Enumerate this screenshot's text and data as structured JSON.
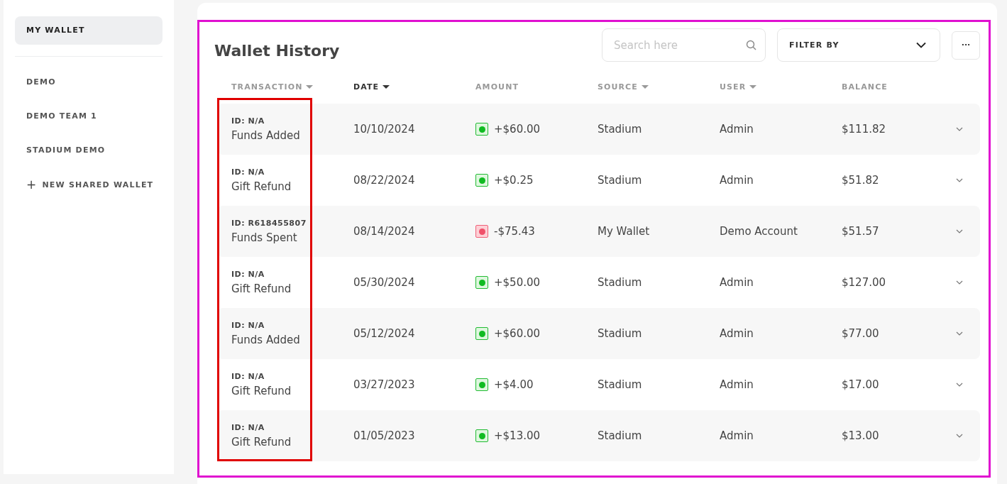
{
  "sidebar": {
    "items": [
      {
        "label": "MY WALLET",
        "selected": true
      },
      {
        "label": "DEMO",
        "selected": false
      },
      {
        "label": "DEMO TEAM 1",
        "selected": false
      },
      {
        "label": "STADIUM DEMO",
        "selected": false
      }
    ],
    "add_button": {
      "icon": "+",
      "label": "NEW SHARED WALLET"
    }
  },
  "wallet_history": {
    "title": "Wallet History",
    "search": {
      "placeholder": "Search here"
    },
    "filter": {
      "label": "FILTER BY"
    },
    "more_button": "···",
    "columns": [
      {
        "label": "TRANSACTION",
        "sortable": true,
        "active": false
      },
      {
        "label": "DATE",
        "sortable": true,
        "active": true
      },
      {
        "label": "AMOUNT",
        "sortable": false,
        "active": false
      },
      {
        "label": "SOURCE",
        "sortable": true,
        "active": false
      },
      {
        "label": "USER",
        "sortable": true,
        "active": false
      },
      {
        "label": "BALANCE",
        "sortable": false,
        "active": false
      }
    ],
    "rows": [
      {
        "id": "ID: N/A",
        "type": "Funds Added",
        "date": "10/10/2024",
        "kind": "credit",
        "amount": "+$60.00",
        "source": "Stadium",
        "user": "Admin",
        "balance": "$111.82"
      },
      {
        "id": "ID: N/A",
        "type": "Gift Refund",
        "date": "08/22/2024",
        "kind": "credit",
        "amount": "+$0.25",
        "source": "Stadium",
        "user": "Admin",
        "balance": "$51.82"
      },
      {
        "id": "ID: R618455807",
        "type": "Funds Spent",
        "date": "08/14/2024",
        "kind": "debit",
        "amount": "-$75.43",
        "source": "My Wallet",
        "user": "Demo Account",
        "balance": "$51.57"
      },
      {
        "id": "ID: N/A",
        "type": "Gift Refund",
        "date": "05/30/2024",
        "kind": "credit",
        "amount": "+$50.00",
        "source": "Stadium",
        "user": "Admin",
        "balance": "$127.00"
      },
      {
        "id": "ID: N/A",
        "type": "Funds Added",
        "date": "05/12/2024",
        "kind": "credit",
        "amount": "+$60.00",
        "source": "Stadium",
        "user": "Admin",
        "balance": "$77.00"
      },
      {
        "id": "ID: N/A",
        "type": "Gift Refund",
        "date": "03/27/2023",
        "kind": "credit",
        "amount": "+$4.00",
        "source": "Stadium",
        "user": "Admin",
        "balance": "$17.00"
      },
      {
        "id": "ID: N/A",
        "type": "Gift Refund",
        "date": "01/05/2023",
        "kind": "credit",
        "amount": "+$13.00",
        "source": "Stadium",
        "user": "Admin",
        "balance": "$13.00"
      }
    ]
  }
}
